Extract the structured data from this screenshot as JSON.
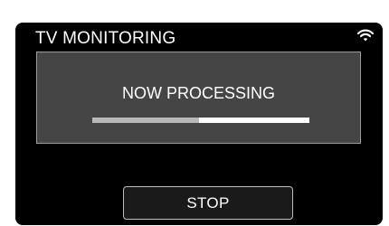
{
  "screen": {
    "title": "TV MONITORING",
    "status_icon": "wifi-icon"
  },
  "dialog": {
    "message": "NOW PROCESSING",
    "progress": 0.49
  },
  "actions": {
    "stop_label": "STOP"
  },
  "colors": {
    "background": "#000000",
    "dialog": "#454545",
    "progress_track": "#ffffff",
    "progress_fill": "#b8b8b8",
    "text": "#ffffff"
  }
}
